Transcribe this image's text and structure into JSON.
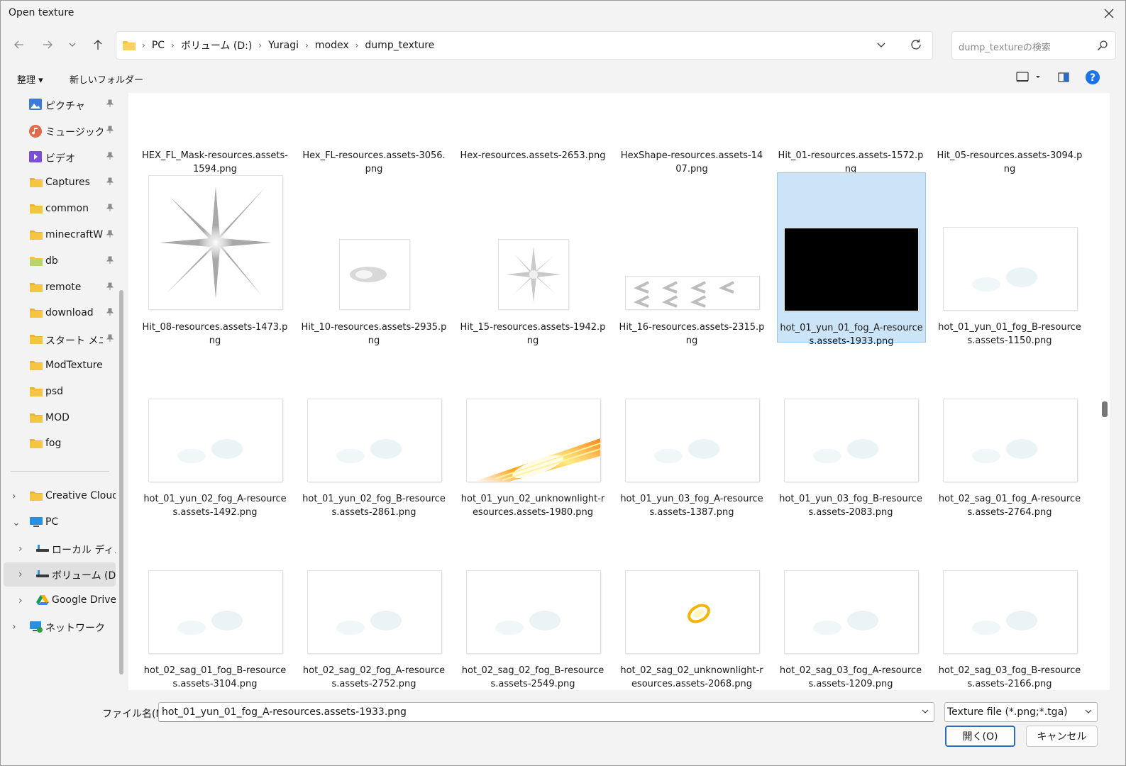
{
  "window": {
    "title": "Open texture"
  },
  "address": {
    "crumbs": [
      "PC",
      "ボリューム (D:)",
      "Yuragi",
      "modex",
      "dump_texture"
    ]
  },
  "search": {
    "placeholder": "dump_textureの検索"
  },
  "commands": {
    "organize": "整理 ▾",
    "new_folder": "新しいフォルダー"
  },
  "sidebar": {
    "pinned": [
      {
        "label": "ピクチャ",
        "icon": "pictures-icon",
        "color": "#3b7ad9"
      },
      {
        "label": "ミュージック",
        "icon": "music-icon",
        "color": "#e06a4a"
      },
      {
        "label": "ビデオ",
        "icon": "videos-icon",
        "color": "#7a4fd6"
      },
      {
        "label": "Captures",
        "icon": "folder-icon",
        "color": "#f4c542"
      },
      {
        "label": "common",
        "icon": "folder-icon",
        "color": "#f4c542"
      },
      {
        "label": "minecraftWorlds",
        "icon": "folder-icon",
        "color": "#f4c542"
      },
      {
        "label": "db",
        "icon": "folder-green-icon",
        "color": "#b9d46a"
      },
      {
        "label": "remote",
        "icon": "folder-icon",
        "color": "#f4c542"
      },
      {
        "label": "download",
        "icon": "folder-icon",
        "color": "#f4c542"
      },
      {
        "label": "スタート メニュー",
        "icon": "folder-icon",
        "color": "#f4c542"
      }
    ],
    "recent": [
      {
        "label": "ModTexture",
        "icon": "folder-icon",
        "color": "#f4c542"
      },
      {
        "label": "psd",
        "icon": "folder-icon",
        "color": "#f4c542"
      },
      {
        "label": "MOD",
        "icon": "folder-icon",
        "color": "#f4c542"
      },
      {
        "label": "fog",
        "icon": "folder-icon",
        "color": "#f4c542"
      }
    ],
    "tree": [
      {
        "label": "Creative Cloud Files",
        "icon": "folder-icon",
        "color": "#f4c542",
        "indent": 0,
        "expanded": false
      },
      {
        "label": "PC",
        "icon": "pc-icon",
        "color": "#2b8fe0",
        "indent": 0,
        "expanded": true
      },
      {
        "label": "ローカル ディスク (C:)",
        "icon": "drive-icon",
        "color": "#3a3a3a",
        "indent": 1,
        "expanded": false
      },
      {
        "label": "ボリューム (D:)",
        "icon": "drive-icon",
        "color": "#3a3a3a",
        "indent": 1,
        "expanded": false,
        "selected": true
      },
      {
        "label": "Google Drive (G:)",
        "icon": "google-drive-icon",
        "color": "#1fa463",
        "indent": 1,
        "expanded": false
      },
      {
        "label": "ネットワーク",
        "icon": "network-icon",
        "color": "#2b8fe0",
        "indent": 0,
        "expanded": false
      }
    ]
  },
  "files": [
    {
      "name": "HEX_FL_Mask-resources.assets-1594.png",
      "thumb": "dark-mask"
    },
    {
      "name": "Hex_FL-resources.assets-3056.png",
      "thumb": "blank"
    },
    {
      "name": "Hex-resources.assets-2653.png",
      "thumb": "hex-faint"
    },
    {
      "name": "HexShape-resources.assets-1407.png",
      "thumb": "gray-blob"
    },
    {
      "name": "Hit_01-resources.assets-1572.png",
      "thumb": "narrow-blank"
    },
    {
      "name": "Hit_05-resources.assets-3094.png",
      "thumb": "cracks"
    },
    {
      "name": "Hit_08-resources.assets-1473.png",
      "thumb": "star-burst"
    },
    {
      "name": "Hit_10-resources.assets-2935.png",
      "thumb": "teardrop"
    },
    {
      "name": "Hit_15-resources.assets-1942.png",
      "thumb": "small-star"
    },
    {
      "name": "Hit_16-resources.assets-2315.png",
      "thumb": "chevrons"
    },
    {
      "name": "hot_01_yun_01_fog_A-resources.assets-1933.png",
      "thumb": "black",
      "selected": true
    },
    {
      "name": "hot_01_yun_01_fog_B-resources.assets-1150.png",
      "thumb": "fog"
    },
    {
      "name": "hot_01_yun_02_fog_A-resources.assets-1492.png",
      "thumb": "fog"
    },
    {
      "name": "hot_01_yun_02_fog_B-resources.assets-2861.png",
      "thumb": "fog"
    },
    {
      "name": "hot_01_yun_02_unknownlight-resources.assets-1980.png",
      "thumb": "light-streak"
    },
    {
      "name": "hot_01_yun_03_fog_A-resources.assets-1387.png",
      "thumb": "fog"
    },
    {
      "name": "hot_01_yun_03_fog_B-resources.assets-2083.png",
      "thumb": "fog"
    },
    {
      "name": "hot_02_sag_01_fog_A-resources.assets-2764.png",
      "thumb": "fog"
    },
    {
      "name": "hot_02_sag_01_fog_B-resources.assets-3104.png",
      "thumb": "fog"
    },
    {
      "name": "hot_02_sag_02_fog_A-resources.assets-2752.png",
      "thumb": "fog"
    },
    {
      "name": "hot_02_sag_02_fog_B-resources.assets-2549.png",
      "thumb": "fog"
    },
    {
      "name": "hot_02_sag_02_unknownlight-resources.assets-2068.png",
      "thumb": "light-spark"
    },
    {
      "name": "hot_02_sag_03_fog_A-resources.assets-1209.png",
      "thumb": "fog"
    },
    {
      "name": "hot_02_sag_03_fog_B-resources.assets-2166.png",
      "thumb": "fog"
    }
  ],
  "footer": {
    "filename_label": "ファイル名(N):",
    "filename_value": "hot_01_yun_01_fog_A-resources.assets-1933.png",
    "filetype": "Texture file (*.png;*.tga)",
    "open": "開く(O)",
    "cancel": "キャンセル"
  },
  "colors": {
    "accent": "#2a6ec1",
    "selection": "#cce4f7",
    "help": "#1a73e8"
  }
}
